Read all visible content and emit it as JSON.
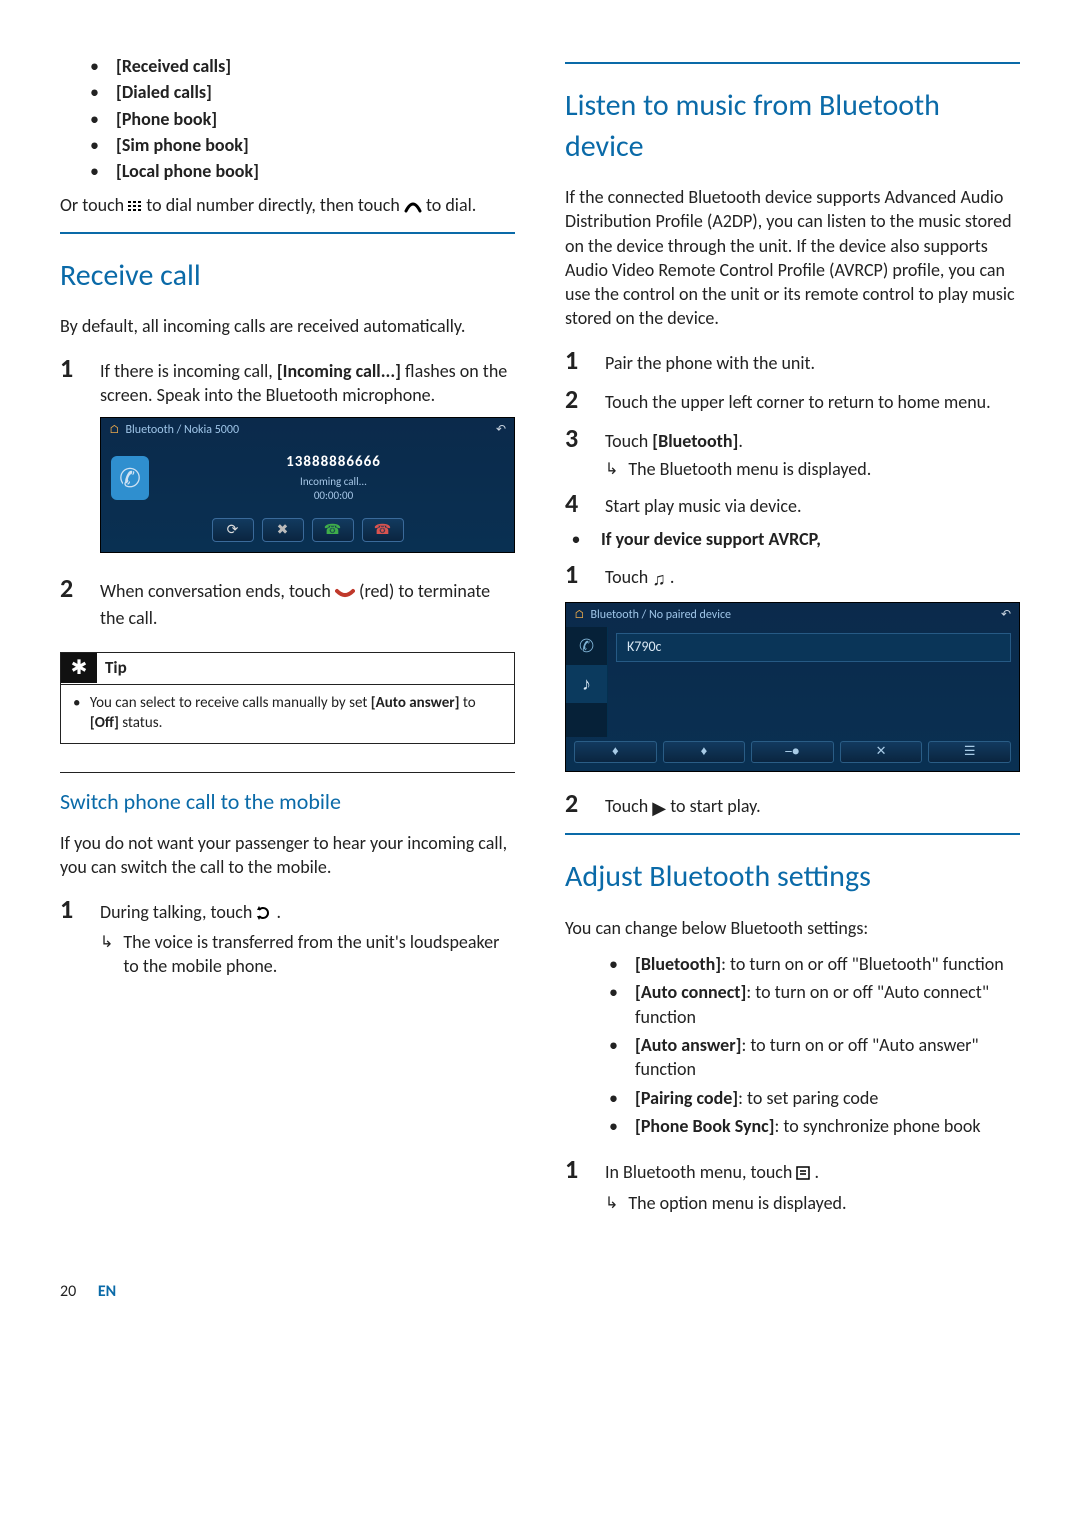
{
  "left": {
    "opts": [
      "[Received calls]",
      "[Dialed calls]",
      "[Phone book]",
      "[Sim phone book]",
      "[Local phone book]"
    ],
    "or_line_a": "Or touch ",
    "or_line_b": " to dial number directly, then touch ",
    "or_line_c": " to dial.",
    "h_receive": "Receive call",
    "receive_intro": " By default, all incoming calls are received automatically.",
    "s1_a": "If there is incoming call, ",
    "s1_b": "[Incoming call...]",
    "s1_c": " flashes on the screen. Speak into the Bluetooth microphone.",
    "dev1": {
      "crumb": "Bluetooth  /  Nokia 5000",
      "number": "13888886666",
      "status": "Incoming call...",
      "time": "00:00:00"
    },
    "s2_a": "When conversation ends, touch ",
    "s2_b": " (red) to terminate the call.",
    "tip_title": "Tip",
    "tip_a": "You can select to receive calls manually by set ",
    "tip_b": "[Auto answer]",
    "tip_c": " to ",
    "tip_d": "[Off]",
    "tip_e": " status.",
    "h_switch": "Switch phone call to the mobile",
    "switch_intro": "If you do not want your passenger to hear your incoming call, you can switch the call to the mobile.",
    "sw1_a": "During talking, touch ",
    "sw1_b": ".",
    "sw1_res": "The voice is transferred from the unit's loudspeaker to the mobile phone."
  },
  "right": {
    "h_listen": "Listen to music from Bluetooth device",
    "listen_intro": "If the connected Bluetooth device supports Advanced Audio Distribution Profile (A2DP), you can listen to the music stored on the device through the unit. If the device also supports Audio Video Remote Control Profile (AVRCP) profile, you can use the control on the unit or its remote control to play music stored on the device.",
    "l1": "Pair the phone with the unit.",
    "l2": "Touch the upper left corner to return to home menu.",
    "l3_a": "Touch ",
    "l3_b": "[Bluetooth]",
    "l3_c": ".",
    "l3_res": "The Bluetooth menu is displayed.",
    "l4": "Start play music via device.",
    "avrcp": "If your device support AVRCP,",
    "a1_a": "Touch ",
    "a1_b": " .",
    "dev2": {
      "crumb": "Bluetooth  /  No paired device",
      "item": "K790c"
    },
    "a2_a": "Touch ",
    "a2_b": " to start play.",
    "h_adjust": "Adjust Bluetooth settings",
    "adjust_intro": "You can change below Bluetooth settings:",
    "settings": [
      {
        "t": "[Bluetooth]",
        "d": ": to turn on or off \"Bluetooth\" function"
      },
      {
        "t": "[Auto connect]",
        "d": ": to turn on or off \"Auto connect\" function"
      },
      {
        "t": "[Auto answer]",
        "d": ": to turn on or off \"Auto answer\" function"
      },
      {
        "t": "[Pairing code]",
        "d": ": to set paring code"
      },
      {
        "t": "[Phone Book Sync]",
        "d": ": to synchronize phone book"
      }
    ],
    "b1_a": "In Bluetooth menu, touch ",
    "b1_b": ".",
    "b1_res": "The option menu is displayed."
  },
  "footer": {
    "page": "20",
    "lang": "EN"
  }
}
